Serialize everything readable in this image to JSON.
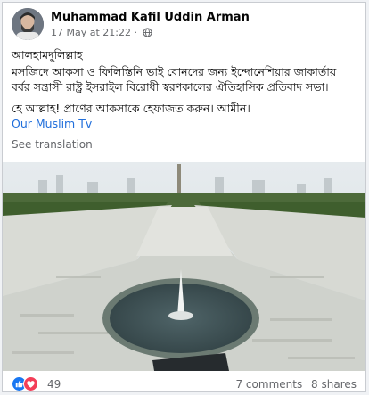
{
  "post": {
    "author": "Muhammad Kafil Uddin Arman",
    "timestamp": "17 May at 21:22",
    "audience_icon": "globe-icon",
    "greeting": "আলহামদুলিল্লাহ",
    "line1": "মসজিদে আকসা ও ফিলিস্তিনি ভাই বোনদের জন্য ইন্দোনেশিয়ার জাকার্তায়",
    "line2": "বর্বর সন্ত্রাসী রাষ্ট্র ইসরাইল বিরোধী স্বরণকালের ঐতিহাসিক প্রতিবাদ সভা।",
    "line3": "হে আল্লাহ! প্রাণের আকসাকে হেফাজত করুন। আমীন।",
    "page_link": "Our Muslim Tv",
    "see_translation": "See translation"
  },
  "footer": {
    "reactions_count": "49",
    "comments": "7 comments",
    "shares": "8 shares"
  },
  "colors": {
    "link": "#216fdb",
    "like": "#1877f2",
    "love": "#f33e58",
    "secondary_text": "#65676b"
  }
}
